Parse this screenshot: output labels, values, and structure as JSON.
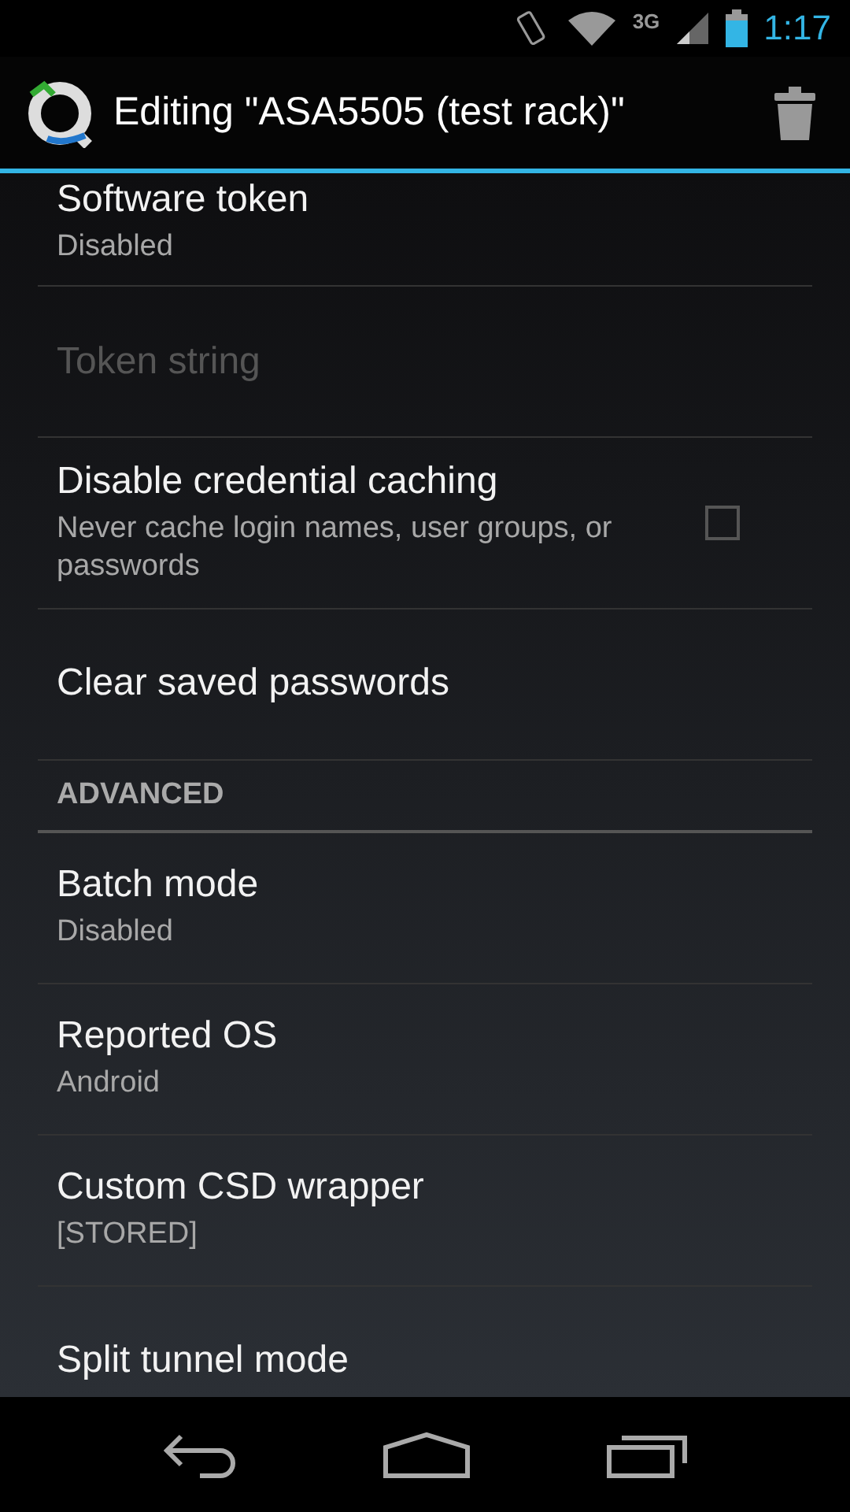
{
  "status_bar": {
    "time": "1:17",
    "network": "3G"
  },
  "action_bar": {
    "title": "Editing \"ASA5505 (test rack)\""
  },
  "preferences": [
    {
      "kind": "preference",
      "title": "Software token",
      "summary": "Disabled",
      "disabled": false
    },
    {
      "kind": "preference",
      "title": "Token string",
      "disabled": true
    },
    {
      "kind": "checkbox",
      "title": "Disable credential caching",
      "summary": "Never cache login names, user groups, or passwords",
      "checked": false,
      "disabled": false
    },
    {
      "kind": "preference",
      "title": "Clear saved passwords",
      "disabled": false
    },
    {
      "kind": "category",
      "title": "ADVANCED"
    },
    {
      "kind": "preference",
      "title": "Batch mode",
      "summary": "Disabled",
      "disabled": false
    },
    {
      "kind": "preference",
      "title": "Reported OS",
      "summary": "Android",
      "disabled": false
    },
    {
      "kind": "preference",
      "title": "Custom CSD wrapper",
      "summary": "[STORED]",
      "disabled": false
    },
    {
      "kind": "preference",
      "title": "Split tunnel mode",
      "disabled": false
    }
  ]
}
